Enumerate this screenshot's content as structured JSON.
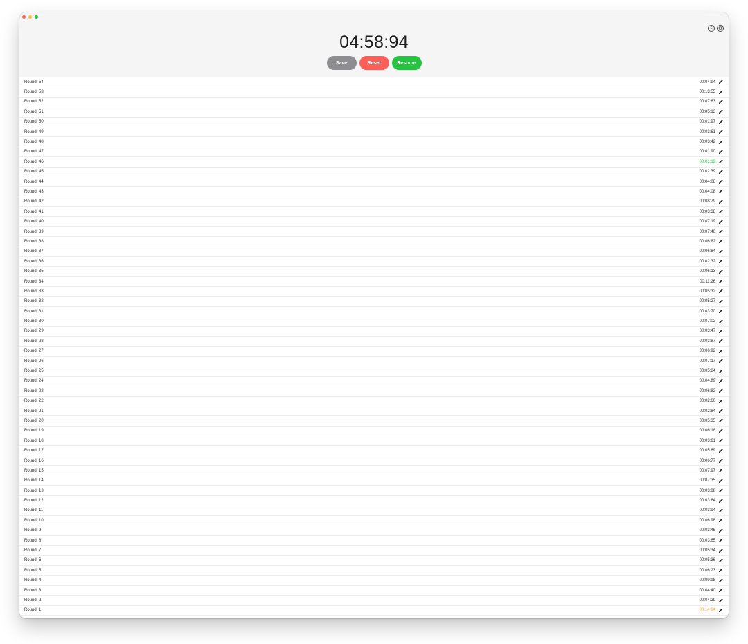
{
  "app": {
    "timer": "04:58:94",
    "buttons": {
      "save": "Save",
      "reset": "Reset",
      "resume": "Resume"
    },
    "icons": [
      "traffic-light-close",
      "traffic-light-minimize",
      "traffic-light-zoom",
      "copyright-icon",
      "gear-icon",
      "pencil-icon"
    ],
    "colors": {
      "fastest": "#28c840",
      "slowest": "#ff9f0a",
      "save": "#8e8e92",
      "reset": "#fe5e58",
      "resume": "#27c340"
    }
  },
  "rounds": [
    {
      "label": "Round: 54",
      "time": "00:04:94",
      "status": ""
    },
    {
      "label": "Round: 53",
      "time": "00:13:55",
      "status": ""
    },
    {
      "label": "Round: 52",
      "time": "00:07:63",
      "status": ""
    },
    {
      "label": "Round: 51",
      "time": "00:05:13",
      "status": ""
    },
    {
      "label": "Round: 50",
      "time": "00:01:97",
      "status": ""
    },
    {
      "label": "Round: 49",
      "time": "00:03:61",
      "status": ""
    },
    {
      "label": "Round: 48",
      "time": "00:03:42",
      "status": ""
    },
    {
      "label": "Round: 47",
      "time": "00:01:90",
      "status": ""
    },
    {
      "label": "Round: 46",
      "time": "00:01:19",
      "status": "fastest"
    },
    {
      "label": "Round: 45",
      "time": "00:02:39",
      "status": ""
    },
    {
      "label": "Round: 44",
      "time": "00:04:08",
      "status": ""
    },
    {
      "label": "Round: 43",
      "time": "00:04:08",
      "status": ""
    },
    {
      "label": "Round: 42",
      "time": "00:08:79",
      "status": ""
    },
    {
      "label": "Round: 41",
      "time": "00:03:38",
      "status": ""
    },
    {
      "label": "Round: 40",
      "time": "00:07:19",
      "status": ""
    },
    {
      "label": "Round: 39",
      "time": "00:07:46",
      "status": ""
    },
    {
      "label": "Round: 38",
      "time": "00:06:82",
      "status": ""
    },
    {
      "label": "Round: 37",
      "time": "00:06:84",
      "status": ""
    },
    {
      "label": "Round: 36",
      "time": "00:02:32",
      "status": ""
    },
    {
      "label": "Round: 35",
      "time": "00:06:13",
      "status": ""
    },
    {
      "label": "Round: 34",
      "time": "00:11:26",
      "status": ""
    },
    {
      "label": "Round: 33",
      "time": "00:05:32",
      "status": ""
    },
    {
      "label": "Round: 32",
      "time": "00:05:27",
      "status": ""
    },
    {
      "label": "Round: 31",
      "time": "00:03:70",
      "status": ""
    },
    {
      "label": "Round: 30",
      "time": "00:07:02",
      "status": ""
    },
    {
      "label": "Round: 29",
      "time": "00:03:47",
      "status": ""
    },
    {
      "label": "Round: 28",
      "time": "00:03:87",
      "status": ""
    },
    {
      "label": "Round: 27",
      "time": "00:06:92",
      "status": ""
    },
    {
      "label": "Round: 26",
      "time": "00:07:17",
      "status": ""
    },
    {
      "label": "Round: 25",
      "time": "00:05:84",
      "status": ""
    },
    {
      "label": "Round: 24",
      "time": "00:04:89",
      "status": ""
    },
    {
      "label": "Round: 23",
      "time": "00:06:82",
      "status": ""
    },
    {
      "label": "Round: 22",
      "time": "00:02:60",
      "status": ""
    },
    {
      "label": "Round: 21",
      "time": "00:02:84",
      "status": ""
    },
    {
      "label": "Round: 20",
      "time": "00:05:35",
      "status": ""
    },
    {
      "label": "Round: 19",
      "time": "00:06:18",
      "status": ""
    },
    {
      "label": "Round: 18",
      "time": "00:03:61",
      "status": ""
    },
    {
      "label": "Round: 17",
      "time": "00:05:69",
      "status": ""
    },
    {
      "label": "Round: 16",
      "time": "00:06:77",
      "status": ""
    },
    {
      "label": "Round: 15",
      "time": "00:07:97",
      "status": ""
    },
    {
      "label": "Round: 14",
      "time": "00:07:35",
      "status": ""
    },
    {
      "label": "Round: 13",
      "time": "00:03:88",
      "status": ""
    },
    {
      "label": "Round: 12",
      "time": "00:03:64",
      "status": ""
    },
    {
      "label": "Round: 11",
      "time": "00:03:94",
      "status": ""
    },
    {
      "label": "Round: 10",
      "time": "00:06:98",
      "status": ""
    },
    {
      "label": "Round: 9",
      "time": "00:03:45",
      "status": ""
    },
    {
      "label": "Round: 8",
      "time": "00:03:65",
      "status": ""
    },
    {
      "label": "Round: 7",
      "time": "00:05:34",
      "status": ""
    },
    {
      "label": "Round: 6",
      "time": "00:05:36",
      "status": ""
    },
    {
      "label": "Round: 5",
      "time": "00:06:23",
      "status": ""
    },
    {
      "label": "Round: 4",
      "time": "00:09:98",
      "status": ""
    },
    {
      "label": "Round: 3",
      "time": "00:04:40",
      "status": ""
    },
    {
      "label": "Round: 2",
      "time": "00:04:29",
      "status": ""
    },
    {
      "label": "Round: 1",
      "time": "00:14:84",
      "status": "slowest"
    }
  ]
}
